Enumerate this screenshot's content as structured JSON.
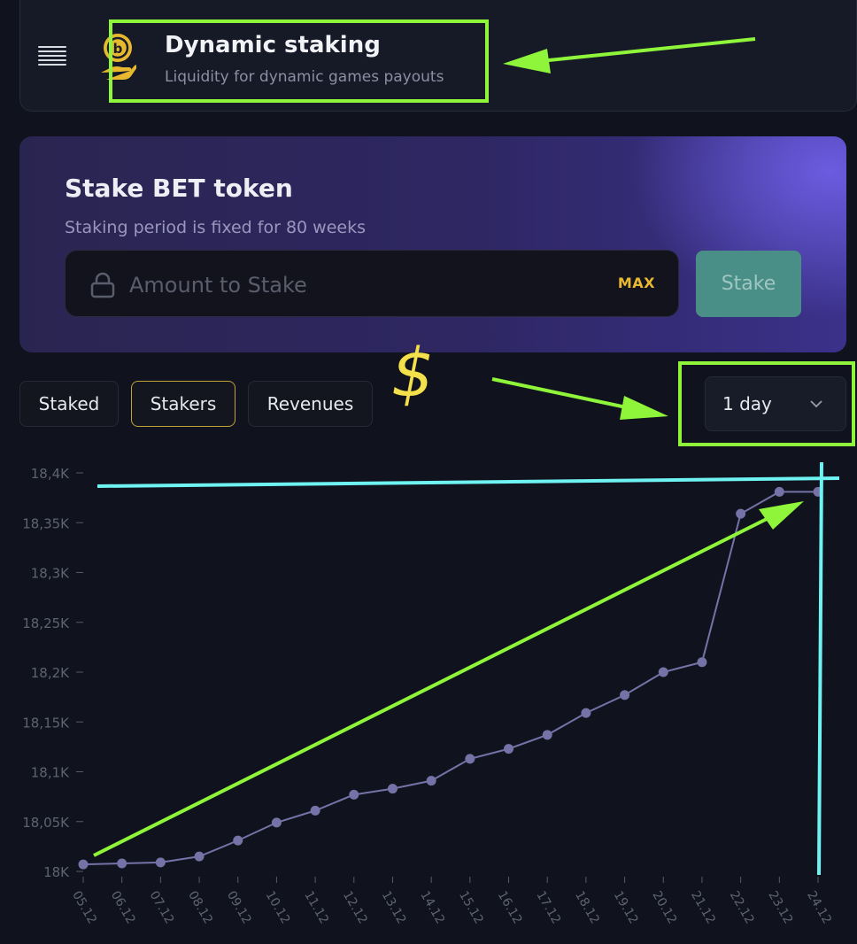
{
  "header": {
    "title": "Dynamic staking",
    "subtitle": "Liquidity for dynamic games payouts",
    "menu_icon": "hamburger-icon",
    "logo_icon": "coin-hand-icon"
  },
  "stake": {
    "title": "Stake BET token",
    "subtitle": "Staking period is fixed for 80 weeks",
    "amount_placeholder": "Amount to Stake",
    "amount_value": "",
    "max_label": "MAX",
    "stake_label": "Stake"
  },
  "tabs": [
    {
      "label": "Staked",
      "active": false
    },
    {
      "label": "Stakers",
      "active": true
    },
    {
      "label": "Revenues",
      "active": false
    }
  ],
  "period": {
    "selected": "1 day"
  },
  "annotations": {
    "symbol": "$"
  },
  "colors": {
    "accent_gold": "#e8b92f",
    "stake_button": "#4a8f87",
    "line": "#7572a8",
    "annotation_green": "#8ef53a",
    "annotation_cyan": "#6ff2f2"
  },
  "chart_data": {
    "type": "line",
    "x": [
      "05.12",
      "06.12",
      "07.12",
      "08.12",
      "09.12",
      "10.12",
      "11.12",
      "12.12",
      "13.12",
      "14.12",
      "15.12",
      "16.12",
      "17.12",
      "18.12",
      "19.12",
      "20.12",
      "21.12",
      "22.12",
      "23.12",
      "24.12"
    ],
    "series": [
      {
        "values": [
          18007,
          18008,
          18009,
          18015,
          18031,
          18049,
          18061,
          18077,
          18083,
          18091,
          18113,
          18123,
          18137,
          18159,
          18177,
          18200,
          18210,
          18359,
          18381,
          18381
        ]
      }
    ],
    "yticks": [
      "18K",
      "18,05K",
      "18,1K",
      "18,15K",
      "18,2K",
      "18,25K",
      "18,3K",
      "18,35K",
      "18,4K"
    ],
    "ylim": [
      18000,
      18400
    ]
  }
}
